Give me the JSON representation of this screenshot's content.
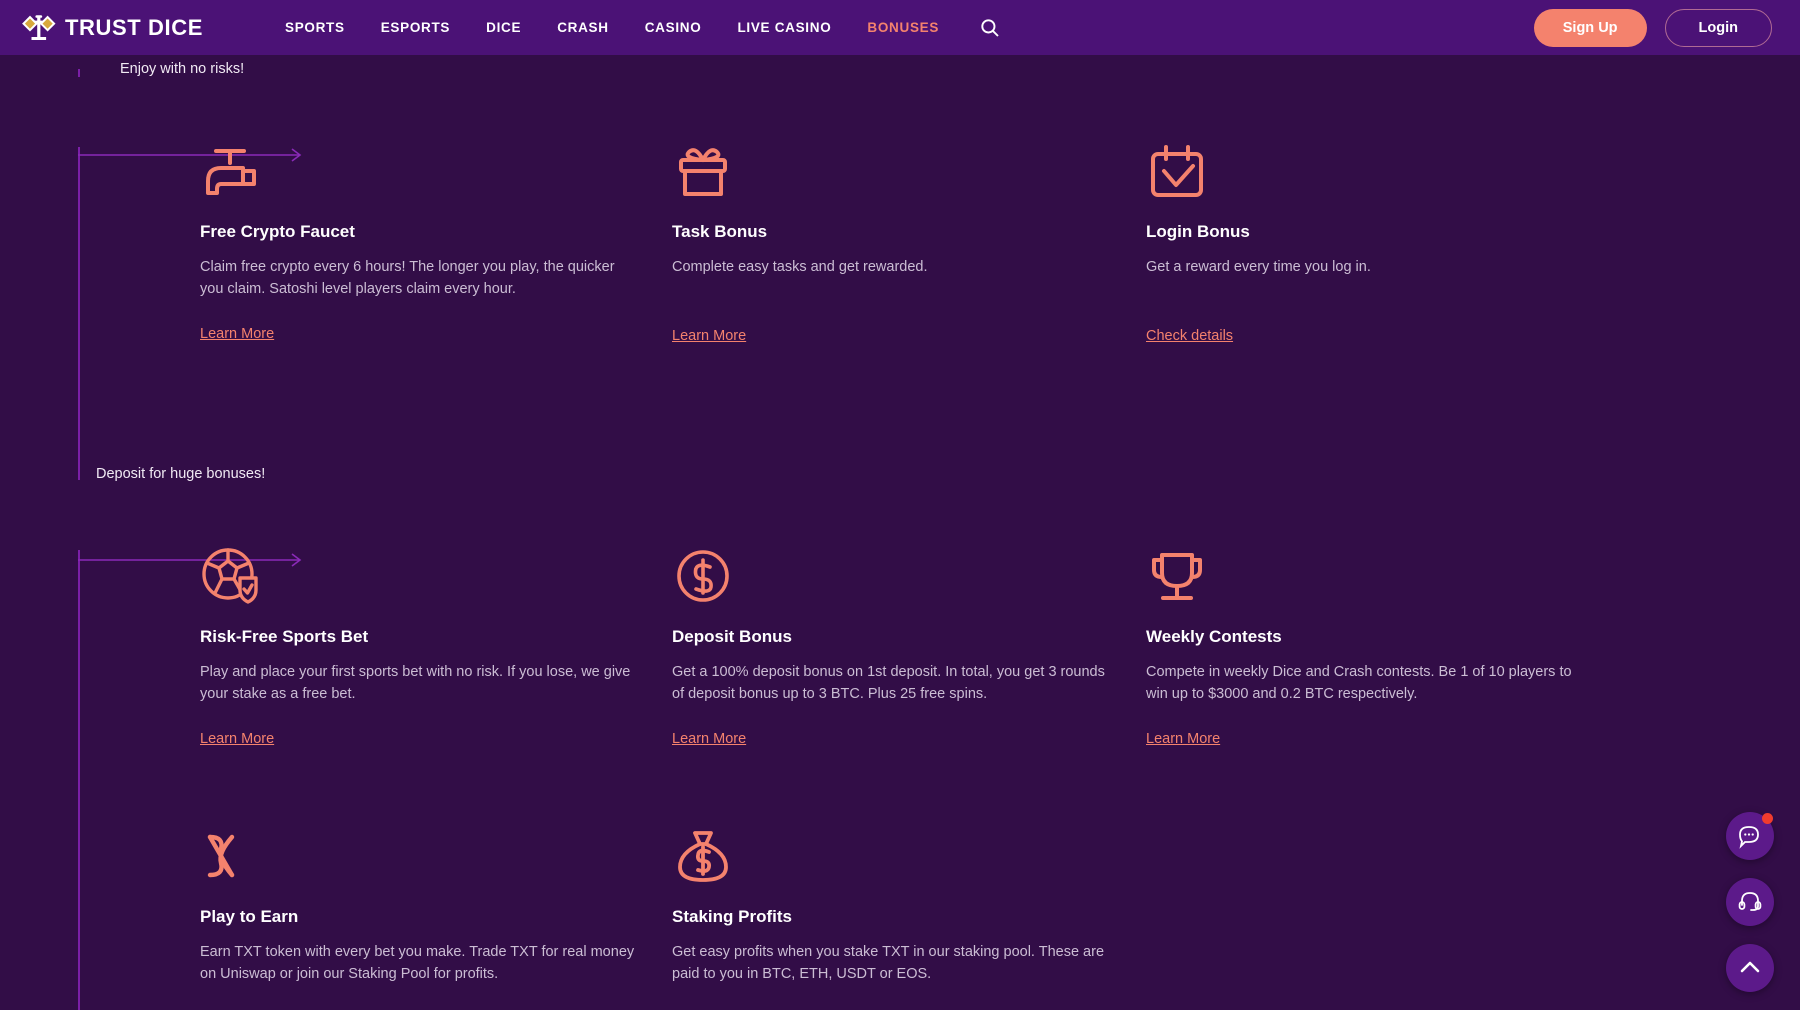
{
  "theme": {
    "page_bg": "#320d47",
    "header_bg": "#4b1276",
    "accent_salmon": "#f4826d",
    "accent_purple": "#7b1fa8",
    "fab_bg": "#5c1a8a",
    "badge_red": "#f03c2e",
    "body_text": "#cbbdd4",
    "logo_gold": "#d8a93c"
  },
  "header": {
    "logo_text": "TRUST DICE",
    "logo_icon": "balance-scale-icon",
    "nav": [
      {
        "label": "SPORTS",
        "active": false
      },
      {
        "label": "ESPORTS",
        "active": false
      },
      {
        "label": "DICE",
        "active": false
      },
      {
        "label": "CRASH",
        "active": false
      },
      {
        "label": "CASINO",
        "active": false
      },
      {
        "label": "LIVE CASINO",
        "active": false
      },
      {
        "label": "BONUSES",
        "active": true
      }
    ],
    "search_icon": "search-icon",
    "sign_up_label": "Sign Up",
    "login_label": "Login"
  },
  "sections": [
    {
      "heading": "Enjoy with no risks!",
      "cards": [
        {
          "icon": "faucet-icon",
          "title": "Free Crypto Faucet",
          "desc": "Claim free crypto every 6 hours! The longer you play, the quicker you claim. Satoshi level players claim every hour.",
          "link": "Learn More"
        },
        {
          "icon": "gift-box-icon",
          "title": "Task Bonus",
          "desc": "Complete easy tasks and get rewarded.",
          "link": "Learn More"
        },
        {
          "icon": "calendar-check-icon",
          "title": "Login Bonus",
          "desc": "Get a reward every time you log in.",
          "link": "Check details"
        }
      ]
    },
    {
      "heading": "Deposit for huge bonuses!",
      "cards": [
        {
          "icon": "soccer-ball-shield-icon",
          "title": "Risk-Free Sports Bet",
          "desc": "Play and place your first sports bet with no risk. If you lose, we give your stake as a free bet.",
          "link": "Learn More"
        },
        {
          "icon": "dollar-circle-icon",
          "title": "Deposit Bonus",
          "desc": "Get a 100% deposit bonus on 1st deposit. In total, you get 3 rounds of deposit bonus up to 3 BTC. Plus 25 free spins.",
          "link": "Learn More"
        },
        {
          "icon": "trophy-icon",
          "title": "Weekly Contests",
          "desc": "Compete in weekly Dice and Crash contests. Be 1 of 10 players to win up to $3000 and 0.2 BTC respectively.",
          "link": "Learn More"
        },
        {
          "icon": "shuffle-x-icon",
          "title": "Play to Earn",
          "desc": "Earn TXT token with every bet you make. Trade TXT for real money on Uniswap or join our Staking Pool for profits.",
          "link": ""
        },
        {
          "icon": "money-bag-icon",
          "title": "Staking Profits",
          "desc": "Get easy profits when you stake TXT in our staking pool. These are paid to you in BTC, ETH, USDT or EOS.",
          "link": ""
        }
      ]
    }
  ],
  "fabs": [
    {
      "icon": "chat-bubble-icon",
      "badge": true
    },
    {
      "icon": "headset-support-icon",
      "badge": false
    },
    {
      "icon": "chevron-up-icon",
      "badge": false
    }
  ]
}
